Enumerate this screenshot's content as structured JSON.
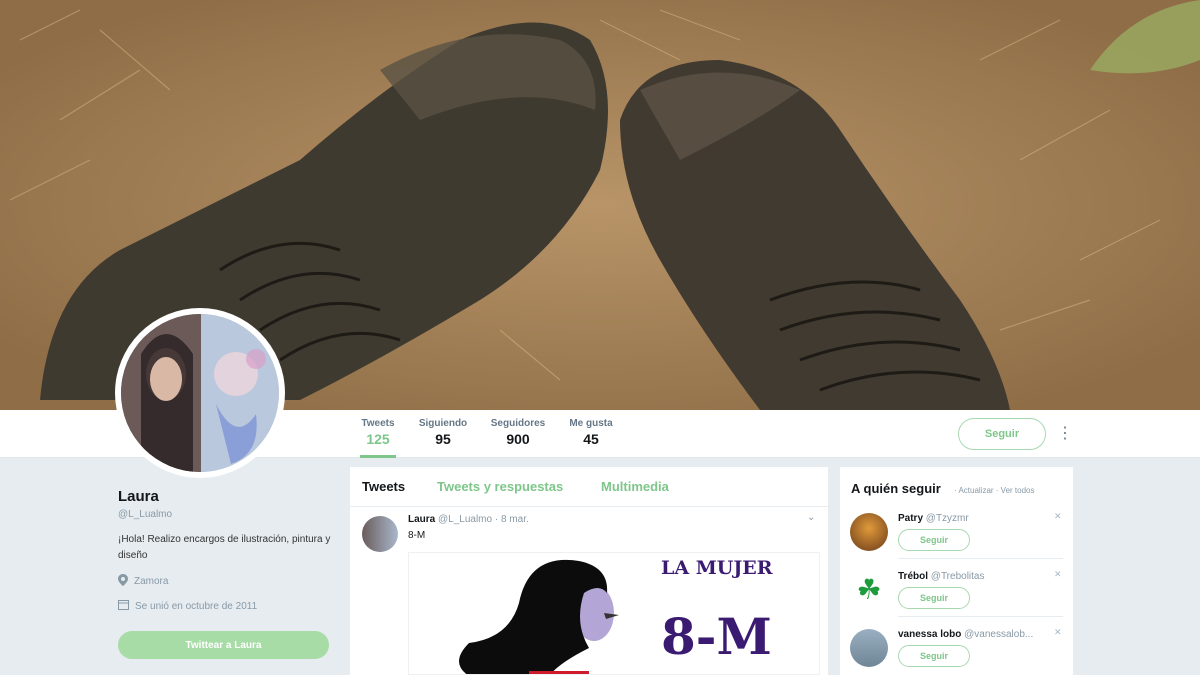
{
  "profile": {
    "name": "Laura",
    "handle": "@L_Lualmo",
    "bio": "¡Hola! Realizo encargos de ilustración, pintura y diseño",
    "location": "Zamora",
    "joined": "Se unió en octubre de 2011",
    "tweet_to_label": "Twittear a Laura"
  },
  "stats": [
    {
      "label": "Tweets",
      "value": "125"
    },
    {
      "label": "Siguiendo",
      "value": "95"
    },
    {
      "label": "Seguidores",
      "value": "900"
    },
    {
      "label": "Me gusta",
      "value": "45"
    }
  ],
  "header": {
    "follow_label": "Seguir",
    "more_icon": "more-vert-icon"
  },
  "timeline": {
    "tabs": [
      "Tweets",
      "Tweets y respuestas",
      "Multimedia"
    ],
    "tweet": {
      "name": "Laura",
      "handle_time": "@L_Lualmo · 8 mar.",
      "text": "8-M",
      "media_line1": "LA MUJER",
      "media_line2": "8-M"
    }
  },
  "who_to_follow": {
    "title": "A quién seguir",
    "links": "· Actualizar · Ver todos",
    "follow_label": "Seguir",
    "suggestions": [
      {
        "name": "Patry",
        "handle": "@Tzyzmr"
      },
      {
        "name": "Trébol",
        "handle": "@Trebolitas"
      },
      {
        "name": "vanessa lobo",
        "handle": "@vanessalob..."
      }
    ]
  },
  "colors": {
    "accent": "#7ec68a",
    "accent_light": "#a7dca6",
    "media_purple": "#3b1b72"
  }
}
